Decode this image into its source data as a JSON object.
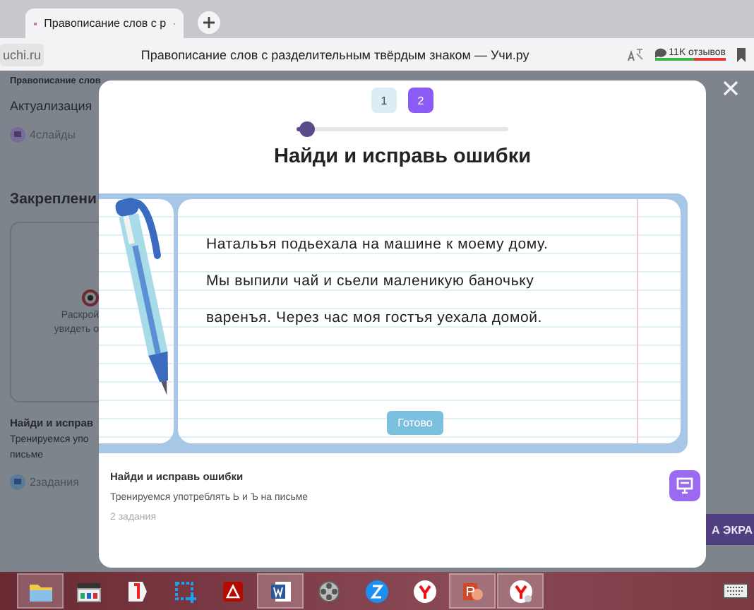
{
  "browser": {
    "tab_title": "Правописание слов с р",
    "url": "uchi.ru",
    "page_title": "Правописание слов с разделительным твёрдым знаком — Учи.ру",
    "reviews": "11K отзывов"
  },
  "background": {
    "breadcrumb": "Правописание слов",
    "stage": "Актуализация",
    "slides": "4слайды",
    "section": "Закреплени",
    "card_lines": [
      "Раскрой",
      "увидеть о"
    ],
    "task_title": "Найди и исправ",
    "task_desc": [
      "Тренируемся упо",
      "письме"
    ],
    "task_count": "2задания",
    "side_button": "А ЭКРА"
  },
  "modal": {
    "steps": [
      {
        "label": "1",
        "selected": false
      },
      {
        "label": "2",
        "selected": true
      }
    ],
    "progress": {
      "level": 0.03
    },
    "title": "Найди и исправь ошибки",
    "lines": [
      "Натальъя подьехала на машине к моему дому.",
      "Мы выпили чай и сьели маленикую баночьку",
      "варенъя. Через час моя гостъя уехала домой."
    ],
    "done_button": "Готово",
    "footer": {
      "title": "Найди и исправь ошибки",
      "subtitle": "Тренируемся употреблять Ь и Ъ на письме",
      "count": "2 задания"
    }
  },
  "taskbar": [
    {
      "kind": "folder",
      "active": true
    },
    {
      "kind": "player",
      "active": false
    },
    {
      "kind": "yandex-flag",
      "active": false
    },
    {
      "kind": "snip",
      "active": false
    },
    {
      "kind": "pdf",
      "active": false
    },
    {
      "kind": "word",
      "active": true
    },
    {
      "kind": "reel",
      "active": false
    },
    {
      "kind": "blue-circle",
      "active": false
    },
    {
      "kind": "yandex-circle",
      "active": false
    },
    {
      "kind": "slides",
      "active": true
    },
    {
      "kind": "yandex-browser",
      "active": true
    }
  ]
}
